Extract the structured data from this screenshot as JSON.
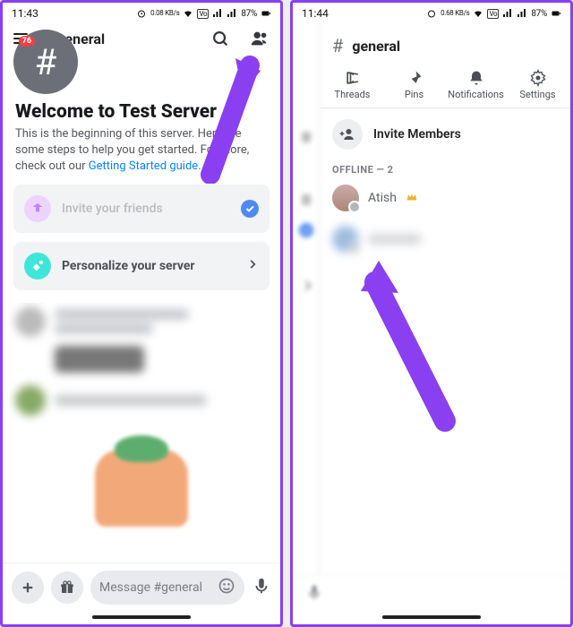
{
  "left": {
    "status": {
      "time": "11:43",
      "net": "0.08 KB/s",
      "battery": "87%"
    },
    "header": {
      "badge": "76",
      "channel": "general"
    },
    "welcome": {
      "title": "Welcome to Test Server",
      "body_a": "This is the beginning of this server. Here are some steps to help you get started. For more, check out our ",
      "link": "Getting Started guide",
      "body_b": "."
    },
    "cards": {
      "invite": "Invite your friends",
      "personalize": "Personalize your server"
    },
    "input": {
      "placeholder": "Message #general"
    }
  },
  "right": {
    "status": {
      "time": "11:44",
      "net": "0.68 KB/s",
      "battery": "87%"
    },
    "header": {
      "channel": "general"
    },
    "tabs": {
      "threads": "Threads",
      "pins": "Pins",
      "notifications": "Notifications",
      "settings": "Settings"
    },
    "action": {
      "invite": "Invite Members"
    },
    "section": "OFFLINE — 2",
    "members": {
      "m1": "Atish"
    }
  }
}
